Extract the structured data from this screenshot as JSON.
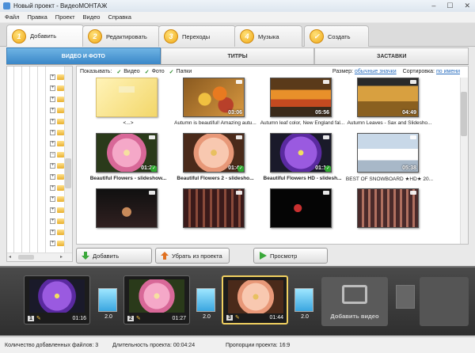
{
  "window": {
    "title": "Новый проект - ВидеоМОНТАЖ"
  },
  "menu": [
    "Файл",
    "Правка",
    "Проект",
    "Видео",
    "Справка"
  ],
  "steps": [
    {
      "num": "1",
      "label": "Добавить"
    },
    {
      "num": "2",
      "label": "Редактировать"
    },
    {
      "num": "3",
      "label": "Переходы"
    },
    {
      "num": "4",
      "label": "Музыка"
    },
    {
      "num": "✓",
      "label": "Создать"
    }
  ],
  "subtabs": [
    "ВИДЕО И ФОТО",
    "ТИТРЫ",
    "ЗАСТАВКИ"
  ],
  "filter": {
    "show_label": "Показывать:",
    "video": "Видео",
    "photo": "Фото",
    "folders": "Папки",
    "size_label": "Размер:",
    "size_value": "обычные значки",
    "sort_label": "Сортировка:",
    "sort_value": "по имени"
  },
  "files": [
    {
      "name": "<...>",
      "duration": "",
      "kind": "folder-up",
      "bold": false,
      "added": false
    },
    {
      "name": "Autumn is beautiful! Amazing autu...",
      "duration": "03:06",
      "kind": "autumn1",
      "bold": false,
      "added": false
    },
    {
      "name": "Autumn leaf color, New England fal...",
      "duration": "05:56",
      "kind": "autumn2",
      "bold": false,
      "added": false
    },
    {
      "name": "Autumn Leaves - Sax and Slidesho...",
      "duration": "04:49",
      "kind": "autumn3",
      "bold": false,
      "added": false
    },
    {
      "name": "Beautiful Flowers - slideshow...",
      "duration": "01:27",
      "kind": "flower-pink",
      "bold": true,
      "added": true
    },
    {
      "name": "Beautiful Flowers 2 - slidesho...",
      "duration": "01:43",
      "kind": "flower-peach",
      "bold": true,
      "added": true
    },
    {
      "name": "Beautiful Flowers HD - slidesh...",
      "duration": "01:16",
      "kind": "flower-purple",
      "bold": true,
      "added": true
    },
    {
      "name": "BEST OF SNOWBOARD ★HD★ 20...",
      "duration": "05:38",
      "kind": "snow",
      "bold": false,
      "added": false
    },
    {
      "name": "",
      "duration": "",
      "kind": "dance1",
      "bold": false,
      "added": false
    },
    {
      "name": "",
      "duration": "",
      "kind": "dance2",
      "bold": false,
      "added": false
    },
    {
      "name": "",
      "duration": "",
      "kind": "dance3",
      "bold": false,
      "added": false
    },
    {
      "name": "",
      "duration": "",
      "kind": "dance4",
      "bold": false,
      "added": false
    }
  ],
  "actions": {
    "add": "Добавить",
    "remove": "Убрать из проекта",
    "preview": "Просмотр"
  },
  "timeline": {
    "clips": [
      {
        "num": "1",
        "duration": "01:16",
        "kind": "flower-purple"
      },
      {
        "num": "2",
        "duration": "01:27",
        "kind": "flower-pink"
      },
      {
        "num": "3",
        "duration": "01:44",
        "kind": "flower-peach"
      }
    ],
    "transitions": [
      "2.0",
      "2.0",
      "2.0"
    ],
    "add_label": "Добавить видео"
  },
  "status": {
    "files_count": "Количество добавленных файлов: 3",
    "duration": "Длительность проекта: 00:04:24",
    "ratio": "Пропорции проекта: 16:9"
  },
  "colors": {
    "tab_active": "#3a87c8",
    "step_badge": "#f0a818",
    "timeline_bg": "#3a3a3a",
    "transition": "#3aa6e0",
    "added_check": "#2fa82f"
  }
}
